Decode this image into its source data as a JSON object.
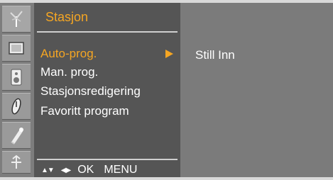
{
  "menu": {
    "title": "Stasjon",
    "items": [
      {
        "label": "Auto-prog.",
        "selected": true
      },
      {
        "label": "Man. prog.",
        "selected": false
      },
      {
        "label": "Stasjonsredigering",
        "selected": false
      },
      {
        "label": "Favoritt program",
        "selected": false
      }
    ],
    "footer": {
      "updown_symbol": "▲▼",
      "leftright_symbol": "◀▶",
      "ok_label": "OK",
      "menu_label": "MENU"
    }
  },
  "submenu": {
    "value": "Still Inn"
  },
  "icons": [
    "antenna-icon",
    "picture-icon",
    "audio-icon",
    "time-icon",
    "special-icon",
    "screen-icon"
  ],
  "colors": {
    "accent": "#f5a623",
    "menu_bg": "#555555",
    "sidebar_bg": "#7d7d7d",
    "sub_bg": "#7b7b7b"
  }
}
